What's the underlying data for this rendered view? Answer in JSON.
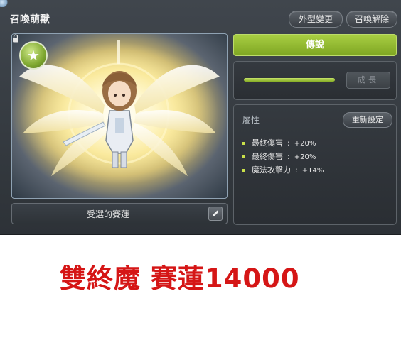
{
  "window": {
    "title": "召喚萌獸"
  },
  "header_buttons": {
    "appearance": "外型變更",
    "release": "召喚解除"
  },
  "portrait": {
    "badge_icon": "star-icon",
    "lock_icon": "lock-icon"
  },
  "pet": {
    "name": "受選的賽蓮"
  },
  "rarity": {
    "label": "傳說",
    "color": "#96bd32"
  },
  "growth": {
    "label": "成長",
    "progress": 1.0
  },
  "attributes": {
    "header": "屬性",
    "reset_label": "重新設定",
    "items": [
      {
        "name": "最終傷害",
        "sep": ":",
        "value": "+20%"
      },
      {
        "name": "最終傷害",
        "sep": ":",
        "value": "+20%"
      },
      {
        "name": "魔法攻擊力",
        "sep": ":",
        "value": "+14%"
      }
    ]
  },
  "caption": {
    "text": "雙終魔 賽蓮14000",
    "color": "#d51616"
  }
}
